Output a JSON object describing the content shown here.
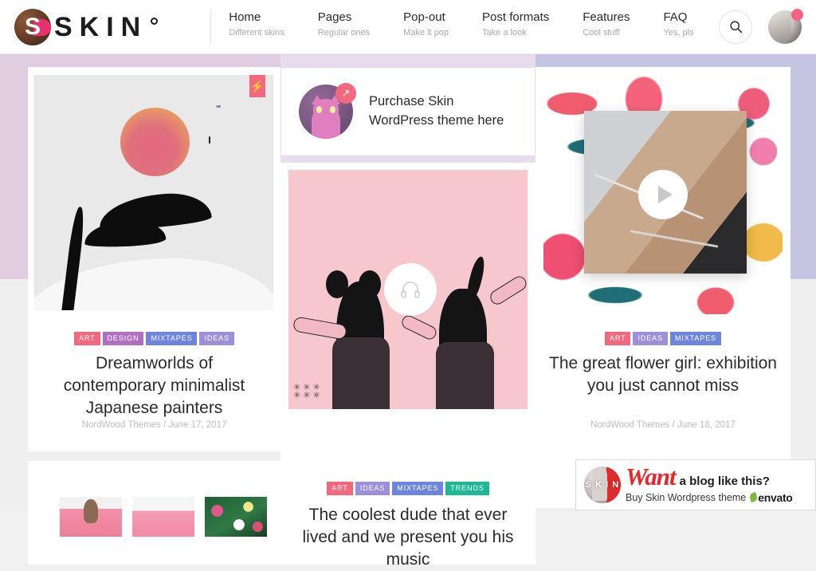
{
  "header": {
    "logo_text": "SKIN",
    "logo_letter": "S",
    "nav": [
      {
        "label": "Home",
        "sub": "Different skins"
      },
      {
        "label": "Pages",
        "sub": "Regular ones"
      },
      {
        "label": "Pop-out",
        "sub": "Make it pop"
      },
      {
        "label": "Post formats",
        "sub": "Take a look"
      },
      {
        "label": "Features",
        "sub": "Cool stuff"
      },
      {
        "label": "FAQ",
        "sub": "Yes, pls"
      }
    ],
    "search_icon": "search-icon",
    "avatar_icon": "user-avatar"
  },
  "promo": {
    "text": "Purchase Skin WordPress theme here",
    "arrow_glyph": "↗",
    "icon": "cat-avatar"
  },
  "posts": [
    {
      "badge_glyph": "⚡",
      "tags": [
        {
          "label": "ART",
          "color": "#f2697f"
        },
        {
          "label": "DESIGN",
          "color": "#b06fc0"
        },
        {
          "label": "MIXTAPES",
          "color": "#6d84e0"
        },
        {
          "label": "IDEAS",
          "color": "#9e8fdc"
        }
      ],
      "title": "Dreamworlds of contemporary minimalist Japanese painters",
      "author": "NordWood Themes",
      "separator": "/",
      "date": "June 17, 2017"
    },
    {
      "media_icon": "headphones-icon",
      "tags": [
        {
          "label": "ART",
          "color": "#f2697f"
        },
        {
          "label": "IDEAS",
          "color": "#9e8fdc"
        },
        {
          "label": "MIXTAPES",
          "color": "#6d84e0"
        },
        {
          "label": "TRENDS",
          "color": "#1fb894"
        }
      ],
      "title": "The coolest dude that ever lived and we present you his music"
    },
    {
      "media_icon": "play-icon",
      "tags": [
        {
          "label": "ART",
          "color": "#f2697f"
        },
        {
          "label": "IDEAS",
          "color": "#9e8fdc"
        },
        {
          "label": "MIXTAPES",
          "color": "#6d84e0"
        }
      ],
      "title": "The great flower girl: exhibition you just cannot miss",
      "author": "NordWood Themes",
      "separator": "/",
      "date": "June 18, 2017"
    }
  ],
  "banner": {
    "want": "Want",
    "rest": "a blog like this?",
    "subtitle": "Buy Skin Wordpress theme",
    "brand": "envato",
    "avatar_text": "S K I N"
  },
  "colors": {
    "accent_pink": "#f2697f",
    "band_left": "#e0cde0",
    "band_right": "#c5c5e2",
    "text_dark": "#2b2b2b",
    "text_muted": "#bdbdbd"
  }
}
